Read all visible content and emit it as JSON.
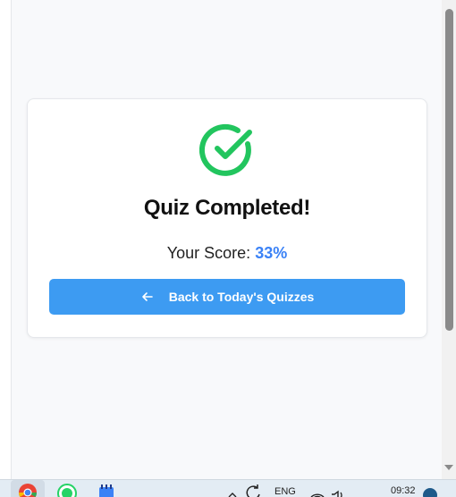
{
  "card": {
    "title": "Quiz Completed!",
    "score_label": "Your Score:",
    "score_value": "33%",
    "back_button_label": "Back to Today's Quizzes"
  },
  "colors": {
    "success_green": "#22c55e",
    "accent_blue": "#3d9bf2",
    "score_blue": "#3b82f6"
  },
  "taskbar": {
    "language": "ENG",
    "time": "09:32",
    "apps": [
      "chrome-icon",
      "whatsapp-icon",
      "notepad-icon"
    ]
  }
}
